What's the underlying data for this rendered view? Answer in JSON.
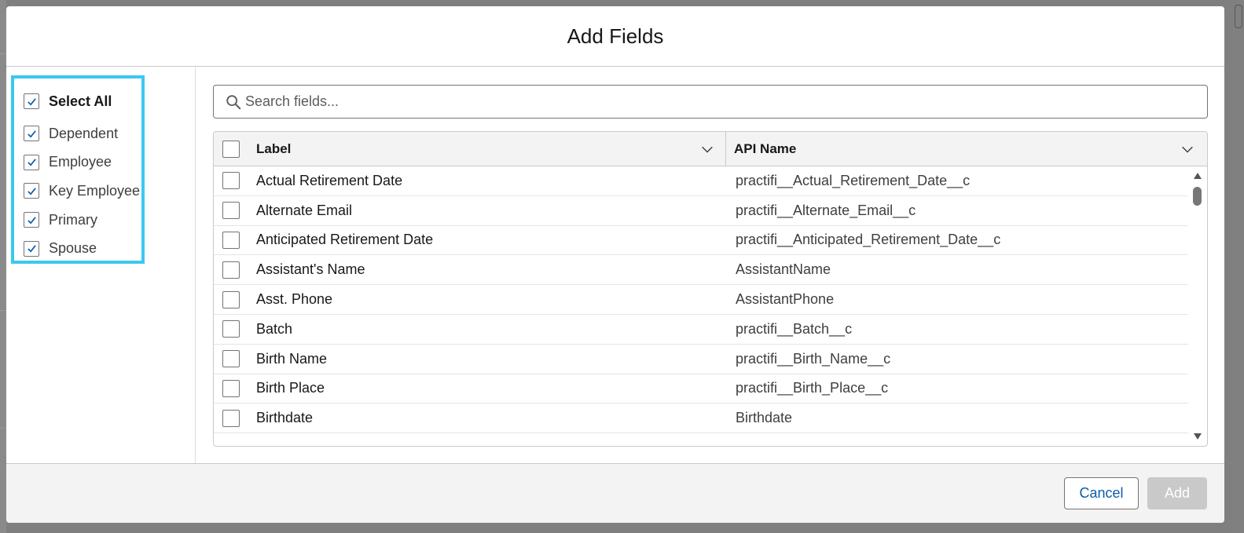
{
  "modal": {
    "title": "Add Fields"
  },
  "filters": {
    "select_all_label": "Select All",
    "items": [
      {
        "label": "Dependent",
        "checked": true
      },
      {
        "label": "Employee",
        "checked": true
      },
      {
        "label": "Key Employee",
        "checked": true
      },
      {
        "label": "Primary",
        "checked": true
      },
      {
        "label": "Spouse",
        "checked": true
      }
    ]
  },
  "search": {
    "placeholder": "Search fields...",
    "icon": "search-icon"
  },
  "table": {
    "columns": [
      "Label",
      "API Name"
    ],
    "rows": [
      {
        "label": "Actual Retirement Date",
        "api": "practifi__Actual_Retirement_Date__c"
      },
      {
        "label": "Alternate Email",
        "api": "practifi__Alternate_Email__c"
      },
      {
        "label": "Anticipated Retirement Date",
        "api": "practifi__Anticipated_Retirement_Date__c"
      },
      {
        "label": "Assistant's Name",
        "api": "AssistantName"
      },
      {
        "label": "Asst. Phone",
        "api": "AssistantPhone"
      },
      {
        "label": "Batch",
        "api": "practifi__Batch__c"
      },
      {
        "label": "Birth Name",
        "api": "practifi__Birth_Name__c"
      },
      {
        "label": "Birth Place",
        "api": "practifi__Birth_Place__c"
      },
      {
        "label": "Birthdate",
        "api": "Birthdate"
      }
    ]
  },
  "footer": {
    "cancel_label": "Cancel",
    "add_label": "Add"
  },
  "colors": {
    "highlight": "#3bc8f0",
    "brand": "#0b5cab",
    "checkmark": "#0b5cab"
  }
}
